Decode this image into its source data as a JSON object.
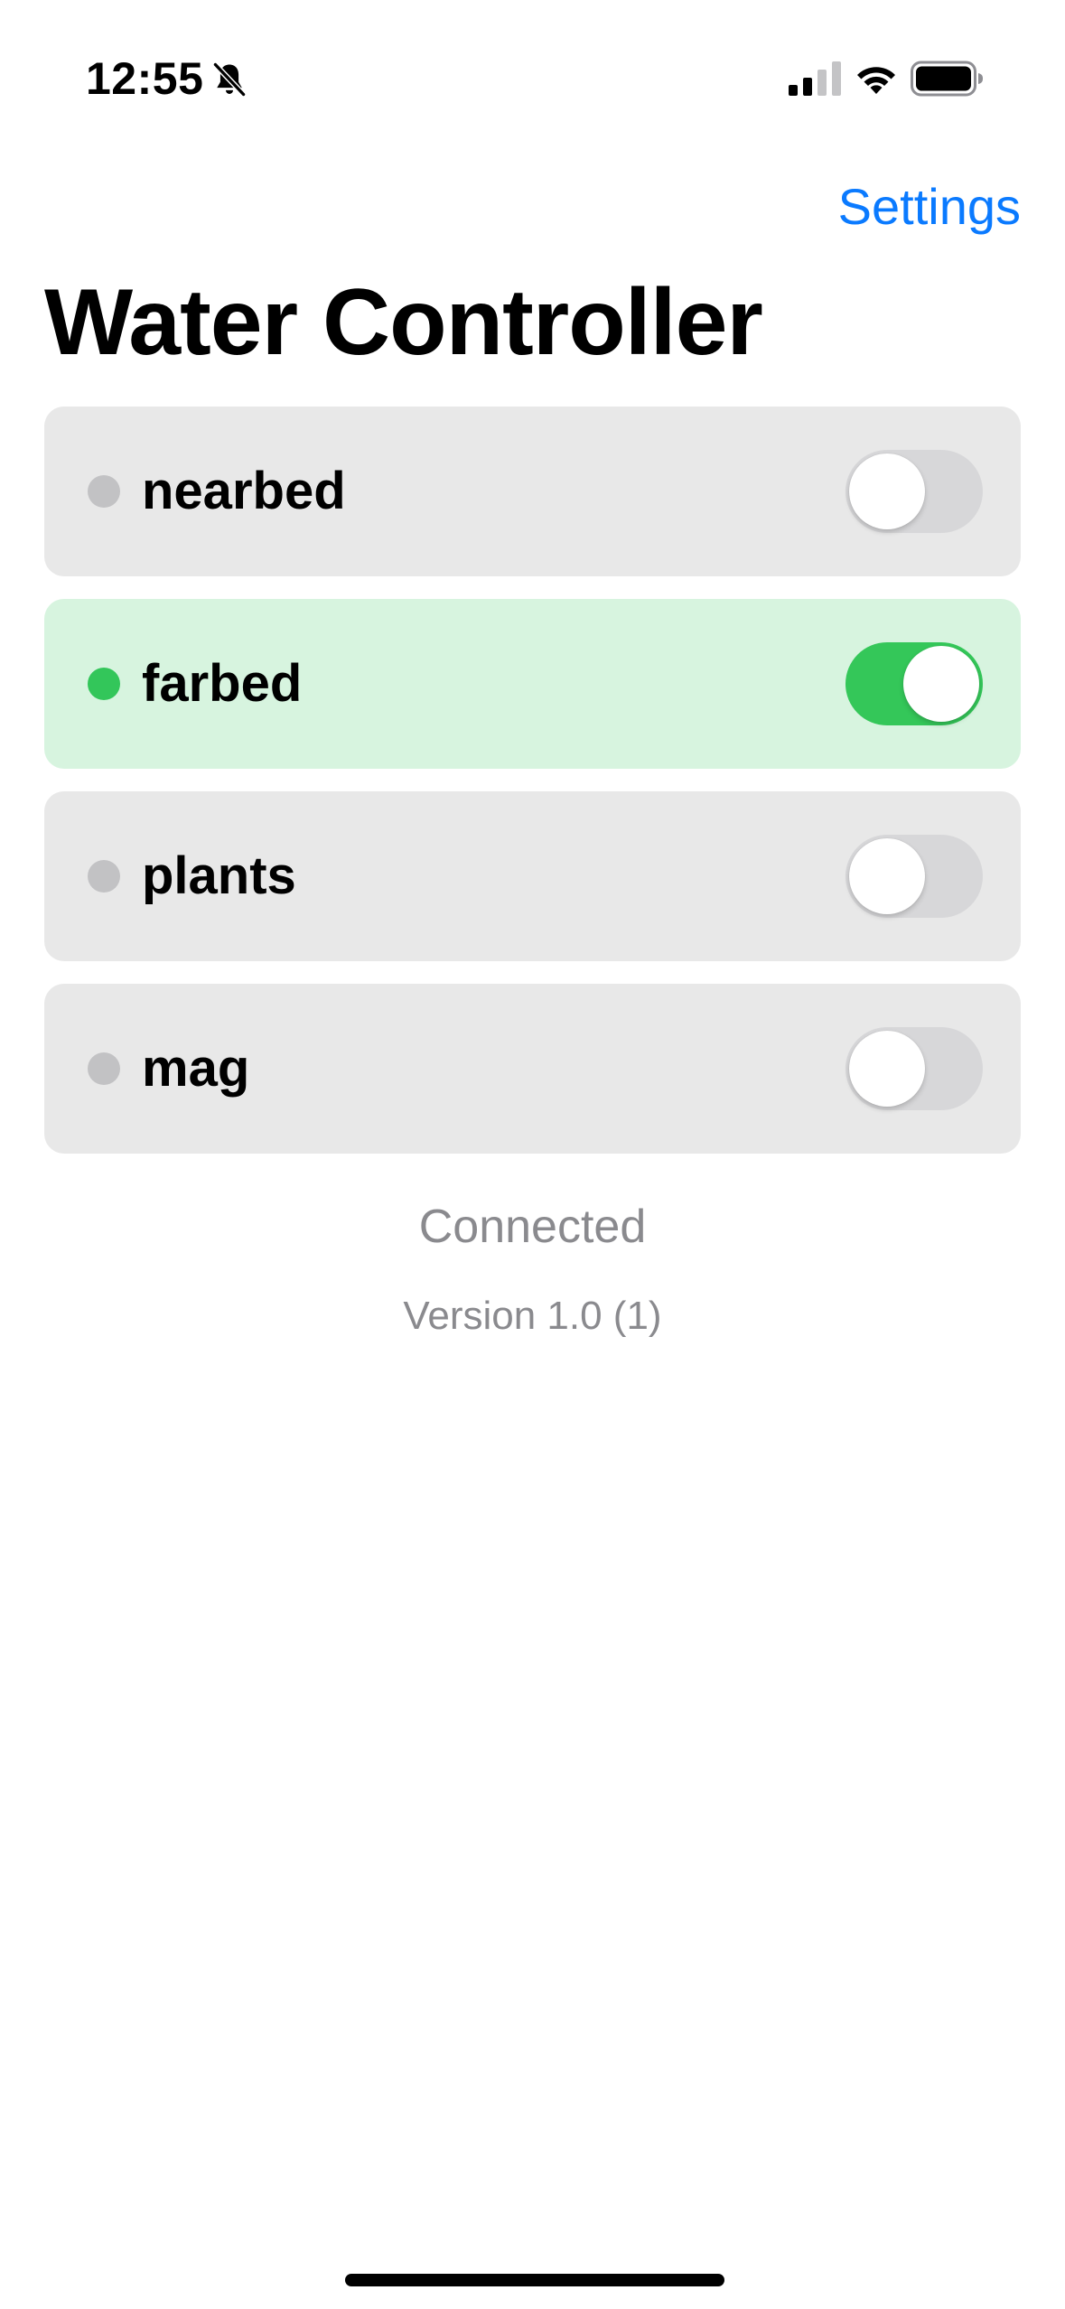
{
  "status_bar": {
    "time": "12:55",
    "icons": [
      "bell-slash-icon",
      "cellular-signal-icon",
      "wifi-icon",
      "battery-icon"
    ]
  },
  "nav": {
    "settings_label": "Settings"
  },
  "page": {
    "title": "Water Controller"
  },
  "zones": [
    {
      "name": "nearbed",
      "on": false
    },
    {
      "name": "farbed",
      "on": true
    },
    {
      "name": "plants",
      "on": false
    },
    {
      "name": "mag",
      "on": false
    }
  ],
  "footer": {
    "connection_status": "Connected",
    "version": "Version 1.0 (1)"
  },
  "colors": {
    "accent": "#0a7aff",
    "active_green": "#34c759",
    "active_row_bg": "#d7f4df",
    "inactive_row_bg": "#e8e8e8",
    "inactive_dot": "#c2c2c4",
    "toggle_off": "#d7d7d9",
    "secondary_text": "#8a8a8e"
  }
}
